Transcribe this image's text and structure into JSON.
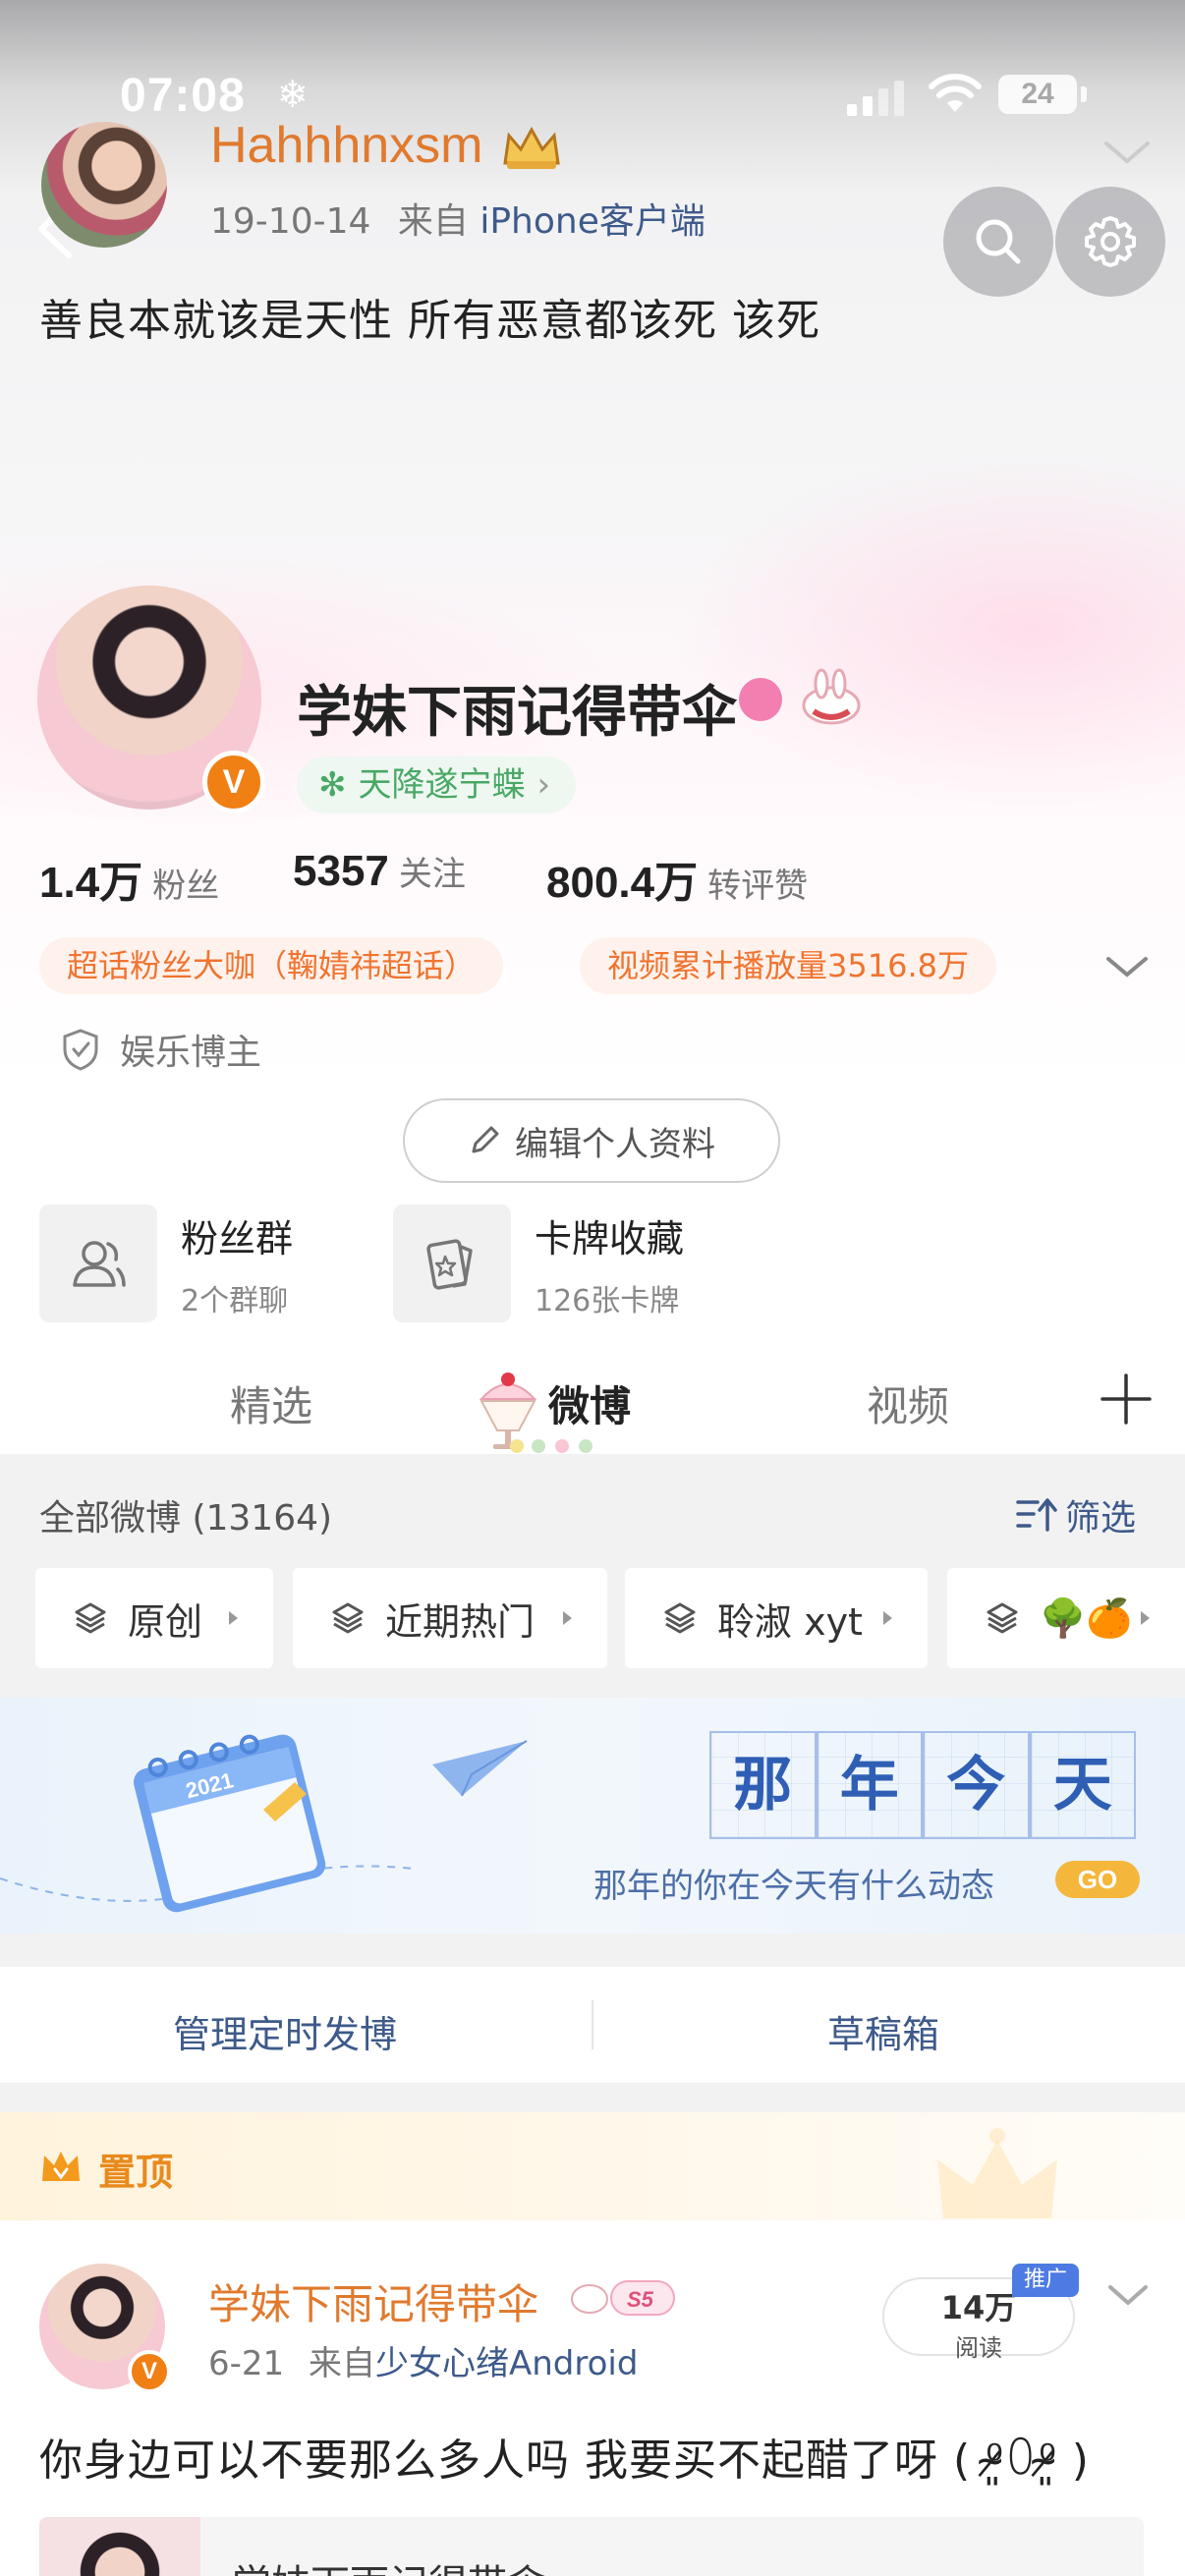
{
  "status": {
    "time": "07:08",
    "battery": "24"
  },
  "original_post": {
    "author": "Hahhhnxsm",
    "date": "19-10-14",
    "from_prefix": "来自",
    "source": "iPhone客户端",
    "text": "善良本就该是天性  所有恶意都该死 该死"
  },
  "profile": {
    "name": "学妹下雨记得带伞",
    "v_badge": "V",
    "tag": "天降遂宁蝶",
    "stats": [
      {
        "num": "1.4万",
        "label": "粉丝"
      },
      {
        "num": "5357",
        "label": "关注"
      },
      {
        "num": "800.4万",
        "label": "转评赞"
      }
    ],
    "honors": [
      "超话粉丝大咖（鞠婧祎超话）",
      "视频累计播放量3516.8万"
    ],
    "category": "娱乐博主",
    "edit_label": "编辑个人资料",
    "entries": [
      {
        "title": "粉丝群",
        "sub": "2个群聊"
      },
      {
        "title": "卡牌收藏",
        "sub": "126张卡牌"
      }
    ]
  },
  "tabs": [
    "精选",
    "微博",
    "视频"
  ],
  "active_tab": "微博",
  "feed": {
    "all_label": "全部微博 (13164)",
    "filter_label": "筛选",
    "chips": [
      "原创",
      "近期热门",
      "聆淑 xyt",
      "🌳🍊"
    ]
  },
  "banner": {
    "title_chars": [
      "那",
      "年",
      "今",
      "天"
    ],
    "subtitle": "那年的你在今天有什么动态",
    "go": "GO",
    "calendar_year": "2021"
  },
  "actions": [
    "管理定时发博",
    "草稿箱"
  ],
  "pinned": {
    "label": "置顶",
    "author": "学妹下雨记得带伞",
    "level": "S5",
    "date": "6-21",
    "from_prefix": "来自",
    "source": "少女心绪Android",
    "reads_num": "14万",
    "reads_label": "阅读",
    "promo": "推广",
    "text": "你身边可以不要那么多人吗 我要买不起醋了呀 ( ⁰̷̴͈꒨⁰̷̴͈ )",
    "quote_author": "学妹下雨记得带伞"
  },
  "colors": {
    "orange": "#e07a2e",
    "link_blue": "#3e5a8a",
    "green": "#4aa866",
    "go_yellow": "#f4b73b",
    "promo_blue": "#4e7be3"
  }
}
